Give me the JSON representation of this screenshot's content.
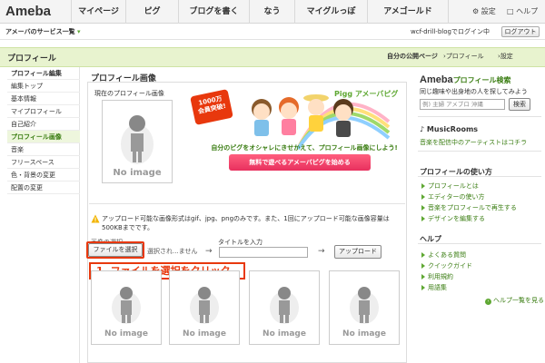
{
  "topnav": {
    "logo": "Ameba",
    "items": [
      "マイページ",
      "ピグ",
      "ブログを書く",
      "なう",
      "マイグルっぽ",
      "アメゴールド"
    ],
    "settings": "設定",
    "help": "ヘルプ"
  },
  "subheader": {
    "services": "アメーバのサービス一覧",
    "login_status": "wcf-drill-blogでログイン中",
    "logout": "ログアウト"
  },
  "band": {
    "title": "プロフィール",
    "links": [
      "自分の公開ページ",
      "プロフィール",
      "設定"
    ]
  },
  "sidebar": {
    "items": [
      "プロフィール編集",
      "編集トップ",
      "基本情報",
      "マイプロフィール",
      "自己紹介",
      "プロフィール画像",
      "音楽",
      "フリースペース",
      "色・背景の変更",
      "配置の変更"
    ]
  },
  "main": {
    "title": "プロフィール画像",
    "current_label": "現在のプロフィール画像",
    "no_image": "No image",
    "banner": {
      "badge_line1": "1000万",
      "badge_line2": "会員突破!",
      "pigg_logo": "Pigg アメーバピグ",
      "caption": "自分のピグをオシャレにきせかえて、プロフィール画像にしよう!",
      "button": "無料で遊べるアメーバピグを始める"
    },
    "notice": "アップロード可能な画像形式はgif、jpg、pngのみです。また、1回にアップロード可能な画像容量は500KBまでです。",
    "select_label": "画像の選択",
    "file_button": "ファイルを選択",
    "no_file": "選択され...ません",
    "arrow": "→",
    "title_label": "タイトルを入力",
    "title_input_value": "",
    "upload_button": "アップロード",
    "callout": "1. ファイルを選択をクリック"
  },
  "right": {
    "search_title_brand": "Ameba",
    "search_title_rest": "プロフィール検索",
    "search_desc": "同じ趣味や出身地の人を探してみよう",
    "search_placeholder": "例) 主婦 アメブロ 沖縄",
    "search_button": "検索",
    "music_title": "MusicRooms",
    "music_link": "音楽を配信中のアーティストはコチラ",
    "howto_title": "プロフィールの使い方",
    "howto_links": [
      "プロフィールとは",
      "エディターの使い方",
      "音楽をプロフィールで再生する",
      "デザインを編集する"
    ],
    "help_title": "ヘルプ",
    "help_links": [
      "よくある質問",
      "クイックガイド",
      "利用規約",
      "用語集"
    ],
    "help_more": "ヘルプ一覧を見る"
  },
  "colors": {
    "accent_green": "#5fa833",
    "callout_red": "#e8380d",
    "band_bg": "#e8f3cf"
  }
}
